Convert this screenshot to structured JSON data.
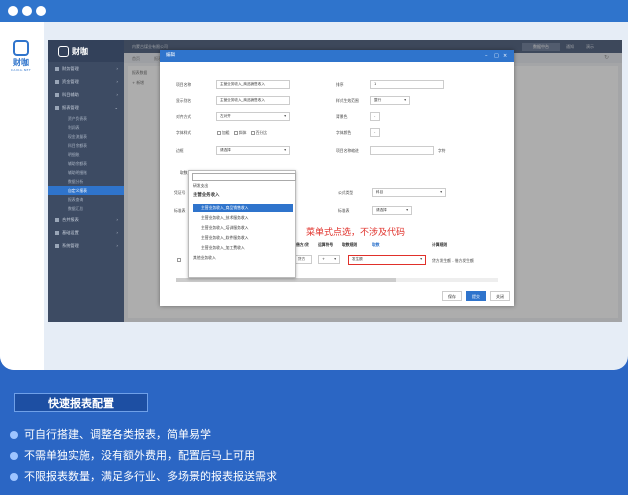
{
  "logo": {
    "text": "财咖",
    "sub": "CAIKA.NET"
  },
  "app": {
    "brand": "财咖",
    "breadcrumb": "内蒙古煤业有限公司",
    "date_button": "数据中台",
    "notify": "通知",
    "user": "演示",
    "tabs": [
      "首页",
      "报表定义"
    ],
    "sidebar": [
      {
        "label": "财务管理"
      },
      {
        "label": "资金管理"
      },
      {
        "label": "科目辅助"
      },
      {
        "label": "报表管理"
      }
    ],
    "sidebar_sub": [
      "资产负债表",
      "利润表",
      "现金流量表",
      "科目余额表",
      "明细账",
      "辅助余额表",
      "辅助明细账",
      "数据分析",
      "自定义报表",
      "报表查询",
      "数据汇总"
    ],
    "sidebar_bottom": [
      {
        "label": "合并报表"
      },
      {
        "label": "基础设置"
      },
      {
        "label": "系统管理"
      }
    ],
    "content": {
      "toolbar": "报表数据",
      "add": "+ 新增"
    }
  },
  "dialog": {
    "title": "编辑",
    "fields": {
      "item_name": {
        "label": "项目名称",
        "value": "主营业务收入_商品销售收入"
      },
      "order": {
        "label": "排序",
        "value": "1"
      },
      "display_name": {
        "label": "显示别名",
        "value": "主营业务收入_商品销售收入"
      },
      "style_range": {
        "label": "样式生效范围",
        "value": "整行"
      },
      "align": {
        "label": "对齐方式",
        "value": "左对齐"
      },
      "bg_color": {
        "label": "背景色",
        "value": "-"
      },
      "font_style": {
        "label": "字体样式",
        "options": [
          "加粗",
          "斜体",
          "百分比"
        ]
      },
      "font_color": {
        "label": "字体颜色",
        "value": "-"
      },
      "border": {
        "label": "边框",
        "value": "请选择"
      },
      "name_indent": {
        "label": "项目名称缩进",
        "value": "",
        "unit": "字符"
      }
    },
    "section_tab": "取数",
    "formula_type": {
      "label": "公式类型",
      "value": "科目"
    },
    "voucher_label": "凭证号",
    "std_label": "标准表",
    "std_value": "请选择",
    "grid_headers": [
      "借方/贷",
      "运算符号",
      "取数规则",
      "取数",
      "计算规则"
    ],
    "grid_row": {
      "subject": "主营业务收入_商品销售收入",
      "direction": "贷方",
      "operator": "+",
      "rule": "发生额",
      "calc": "贷方发生额 - 借方发生额"
    },
    "buttons": {
      "save": "保存",
      "submit": "提交",
      "close": "关闭"
    }
  },
  "dropdown": {
    "options": [
      {
        "text": "研发支出",
        "kind": "top"
      },
      {
        "text": "主营业务收入",
        "kind": "group"
      },
      {
        "text": "主营业务收入_商品销售收入",
        "kind": "child",
        "selected": true
      },
      {
        "text": "主营业务收入_技术服务收入",
        "kind": "child"
      },
      {
        "text": "主营业务收入_培训服务收入",
        "kind": "child"
      },
      {
        "text": "主营业务收入_软件服务收入",
        "kind": "child"
      },
      {
        "text": "主营业务收入_加工费收入",
        "kind": "child"
      },
      {
        "text": "其他业务收入",
        "kind": "top"
      }
    ]
  },
  "annotation": "菜单式点选，不涉及代码",
  "promo": {
    "title": "快速报表配置",
    "features": [
      "可自行搭建、调整各类报表，简单易学",
      "不需单独实施，没有额外费用，配置后马上可用",
      "不限报表数量，满足多行业、多场景的报表报送需求"
    ]
  },
  "colors": {
    "accent": "#2f74cc",
    "background": "#2b66c4",
    "sidebar": "#3d4b63",
    "highlight_red": "#e0302a"
  }
}
